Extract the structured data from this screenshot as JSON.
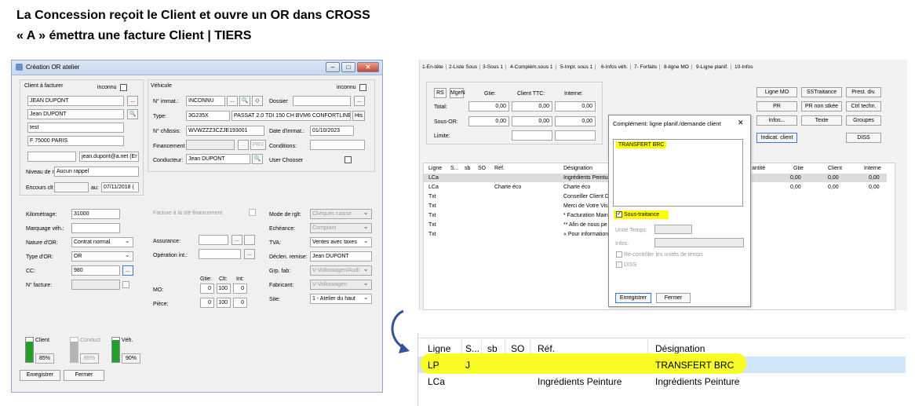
{
  "heading": {
    "line1": "La Concession reçoit le Client et ouvre un OR dans CROSS",
    "line2": "« A » émettra une facture Client | TIERS"
  },
  "left_window": {
    "title": "Création OR atelier",
    "client_section": {
      "title": "Client à facturer",
      "inconnu_label": "inconnu",
      "name1": "JEAN DUPONT",
      "name2": "Jean DUPONT",
      "line3": "test",
      "city": "F 75000 PARIS",
      "email": "jean.dupont@a.net (Er",
      "niveau_label": "Niveau de r",
      "niveau_value": "Aucun rappel",
      "encours_label": "Encours clt",
      "au_label": "au:",
      "au_value": "07/11/2018 (",
      "more_button": "...",
      "search_icon": "search-icon"
    },
    "vehicle_section": {
      "title": "Véhicule",
      "inconnu_label": "inconnu",
      "immat_label": "N° immat.:",
      "immat_value": "INCONNU",
      "dossier_label": "Dossier",
      "type_label": "Type:",
      "type_value": "3G235X",
      "type_desc": "PASSAT 2.0 TDI 150 CH BVM6 CONFORTLINE",
      "his_button": "His",
      "chassis_label": "N° châssis:",
      "chassis_value": "WVWZZZ3CZJE193001",
      "date_immat_label": "Date d'immat.:",
      "date_immat_value": "01/10/2023",
      "financement_label": "Financement",
      "pbv_button": "PBV",
      "conditions_label": "Conditions:",
      "conducteur_label": "Conducteur:",
      "conducteur_value": "Jean DUPONT",
      "user_chooser_label": "User Chooser"
    },
    "lower": {
      "km_label": "Kilométrage:",
      "km_value": "31000",
      "marquage_label": "Marquage véh.:",
      "nature_label": "Nature d'OR:",
      "nature_value": "Contrat normal",
      "type_or_label": "Type d'OR:",
      "type_or_value": "OR",
      "cc_label": "CC:",
      "cc_value": "980",
      "facture_label": "N° facture:",
      "facture_sf_label": "Facture à la sté financement",
      "assurance_label": "Assurance:",
      "operation_label": "Opération int.:",
      "gtie_label": "Gtie:",
      "clt_label": "Clt:",
      "int_label": "Int:",
      "mo_label": "MO:",
      "mo_values": [
        "0",
        "100",
        "0"
      ],
      "piece_label": "Pièce:",
      "piece_values": [
        "0",
        "100",
        "0"
      ],
      "mode_rglt_label": "Mode de rglt:",
      "mode_rglt_value": "Chèques caisse",
      "echeance_label": "Echéance:",
      "echeance_value": "Comptant",
      "tva_label": "TVA:",
      "tva_value": "Ventes avec taxes",
      "declen_label": "Déclen. remise:",
      "declen_value": "Jean DUPONT",
      "grp_fab_label": "Grp. fab:",
      "grp_fab_value": "V-Volkswagen/Audi",
      "fabricant_label": "Fabricant:",
      "fabricant_value": "V-Volkswagen",
      "site_label": "Site:",
      "site_value": "1 - Atelier du haut"
    },
    "gauges": [
      {
        "label": "Client",
        "value": "85%",
        "fraction": 0.85,
        "color": "#22a02a",
        "enabled": true
      },
      {
        "label": "Conduct.",
        "value": "85%",
        "fraction": 0.85,
        "color": "#b4b4b4",
        "enabled": false
      },
      {
        "label": "Véh.",
        "value": "90%",
        "fraction": 0.9,
        "color": "#22a02a",
        "enabled": true
      }
    ],
    "buttons": {
      "save": "Enregistrer",
      "close": "Fermer"
    }
  },
  "right_window": {
    "tabs": [
      "1-En-tête",
      "2-Liste Sous",
      "3-Sous 1",
      "4-Complém.sous 1",
      "5-Impr. sous 1",
      "6-Infos véh.",
      "7- Forfaits",
      "8-ligne MO",
      "9-Ligne planif.",
      "10-Infos"
    ],
    "top_buttons": [
      "RS",
      "MgeN"
    ],
    "col_headers": [
      "Gtie:",
      "Client TTC:",
      "Interne:"
    ],
    "rows": [
      {
        "label": "Total:",
        "values": [
          "0,00",
          "0,00",
          "0,00"
        ]
      },
      {
        "label": "Sous-OR:",
        "values": [
          "0,00",
          "0,00",
          "0,00"
        ]
      },
      {
        "label": "Limite:",
        "values": []
      }
    ],
    "side_buttons": [
      [
        "Ligne MO",
        "SSTraitance",
        "Prest. div."
      ],
      [
        "PR",
        "PR non stkée",
        "Ctrl techn."
      ],
      [
        "Infos...",
        "Texte",
        "Groupes"
      ],
      [
        "Indicat. client",
        "",
        "DISS"
      ]
    ],
    "grid": {
      "headers": [
        "Ligne",
        "S...",
        "sb",
        "SO",
        "Réf.",
        "Désignation"
      ],
      "right_headers": [
        "antité",
        "Gtie",
        "Client",
        "Interne"
      ],
      "rows": [
        {
          "ligne": "LCa",
          "designation": "Ingrédients Peinture",
          "ref": "",
          "right": [
            "0,00",
            "0,00",
            "0,00"
          ]
        },
        {
          "ligne": "LCa",
          "designation": "Charte éco",
          "ref": "Charte éco",
          "right": [
            "0,00",
            "0,00",
            "0,00"
          ]
        },
        {
          "ligne": "Txt",
          "designation": "Conseiller Client Di",
          "ref": "",
          "right": []
        },
        {
          "ligne": "Txt",
          "designation": "Merci de Votre Visi",
          "ref": "",
          "right": []
        },
        {
          "ligne": "Txt",
          "designation": "* Facturation Main",
          "ref": "",
          "right": []
        },
        {
          "ligne": "Txt",
          "designation": "** Afin de nous pe",
          "ref": "",
          "right": []
        },
        {
          "ligne": "Txt",
          "designation": "« Pour information",
          "ref": "",
          "right": []
        }
      ]
    },
    "dialog": {
      "title": "Complément: ligne planif./demande client",
      "close": "✕",
      "memo": "TRANSFERT BRC",
      "sous_traitance": "Sous-traitance",
      "unite_temps_label": "Unité Temps:",
      "infos_label": "Infos:",
      "recontroler": "Ré-contrôler les unités de temps",
      "diss": "DISS",
      "save": "Enregistrer",
      "close_button": "Fermer"
    }
  },
  "zoom": {
    "headers": [
      "Ligne",
      "S...",
      "sb",
      "SO",
      "Réf.",
      "Désignation"
    ],
    "rows": [
      {
        "ligne": "LP",
        "s": "J",
        "ref": "",
        "designation": "TRANSFERT BRC"
      },
      {
        "ligne": "LCa",
        "s": "",
        "ref": "Ingrédients Peinture",
        "designation": "Ingrédients Peinture"
      }
    ]
  },
  "colors": {
    "highlight": "#ffff00",
    "selection": "#cfe5f9",
    "accent": "#3a7ad0"
  }
}
